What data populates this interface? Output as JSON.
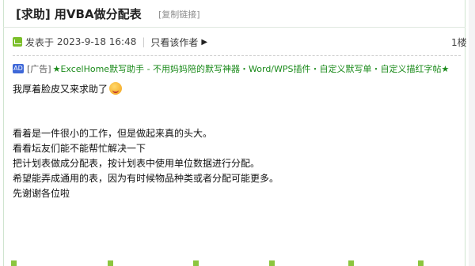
{
  "post": {
    "title": "[求助] 用VBA做分配表",
    "copy_link": "[复制链接]",
    "meta": {
      "posted_prefix": "发表于",
      "datetime": "2023-9-18 16:48",
      "separator": "|",
      "only_author": "只看该作者",
      "floor": "1楼"
    },
    "ad": {
      "badge": "AD",
      "label": "[广告]",
      "text": "★ExcelHome默写助手 - 不用妈妈陪的默写神器・Word/WPS插件・自定义默写单・自定义描红字帖★"
    },
    "lines": [
      "我厚着脸皮又来求助了",
      "看着是一件很小的工作，但是做起来真的头大。",
      "看看坛友们能不能帮忙解决一下",
      "把计划表做成分配表，按计划表中使用单位数据进行分配。",
      "希望能弄成通用的表，因为有时候物品种类或者分配可能更多。",
      "先谢谢各位啦"
    ]
  }
}
